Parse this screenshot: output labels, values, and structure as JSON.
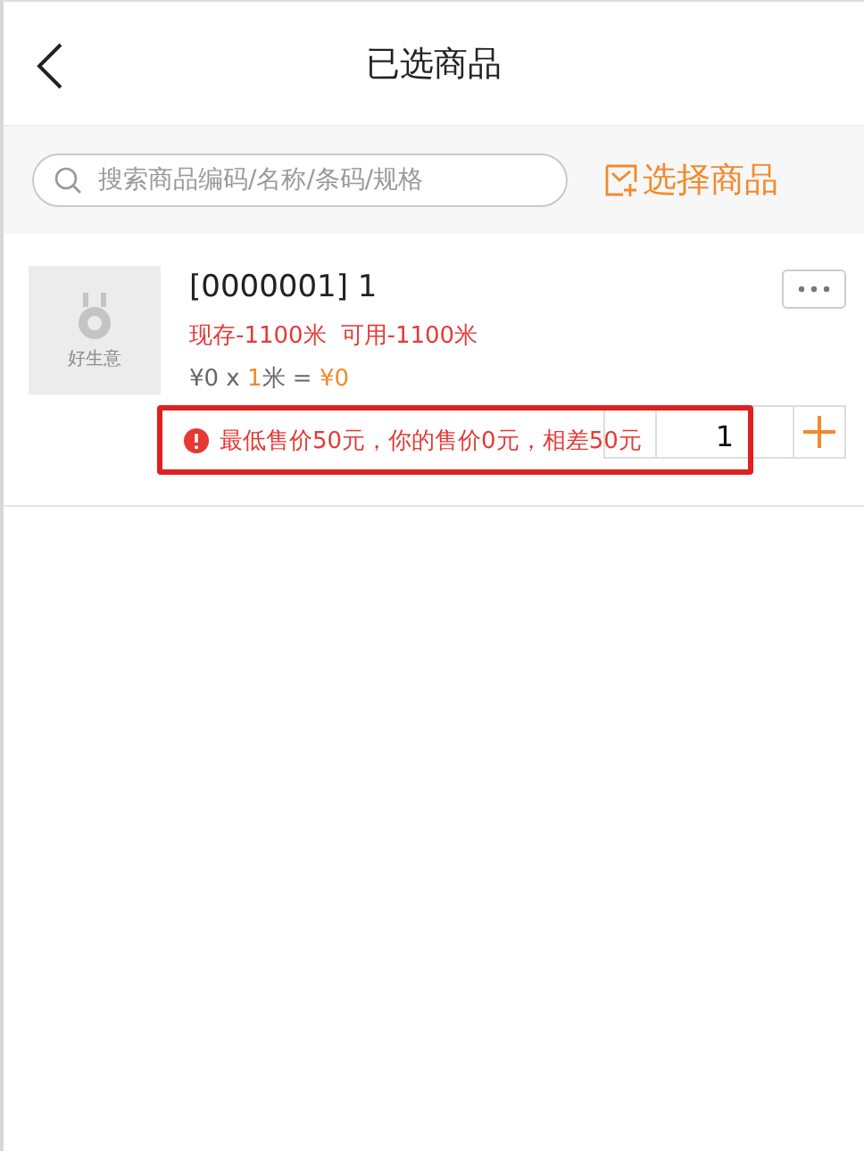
{
  "header": {
    "title": "已选商品"
  },
  "search": {
    "placeholder": "搜索商品编码/名称/条码/规格"
  },
  "select_button": "选择商品",
  "items": [
    {
      "image_label": "好生意",
      "title": "[0000001] 1",
      "stock": [
        "现存-1100米",
        "可用-1100米"
      ],
      "price_line": [
        {
          "text": "¥0 x ",
          "highlight": false
        },
        {
          "text": "1",
          "highlight": true
        },
        {
          "text": "米 = ",
          "highlight": false
        },
        {
          "text": "¥0",
          "highlight": true
        }
      ],
      "quantity": "1",
      "warning": "最低售价50元，你的售价0元，相差50元"
    }
  ]
}
